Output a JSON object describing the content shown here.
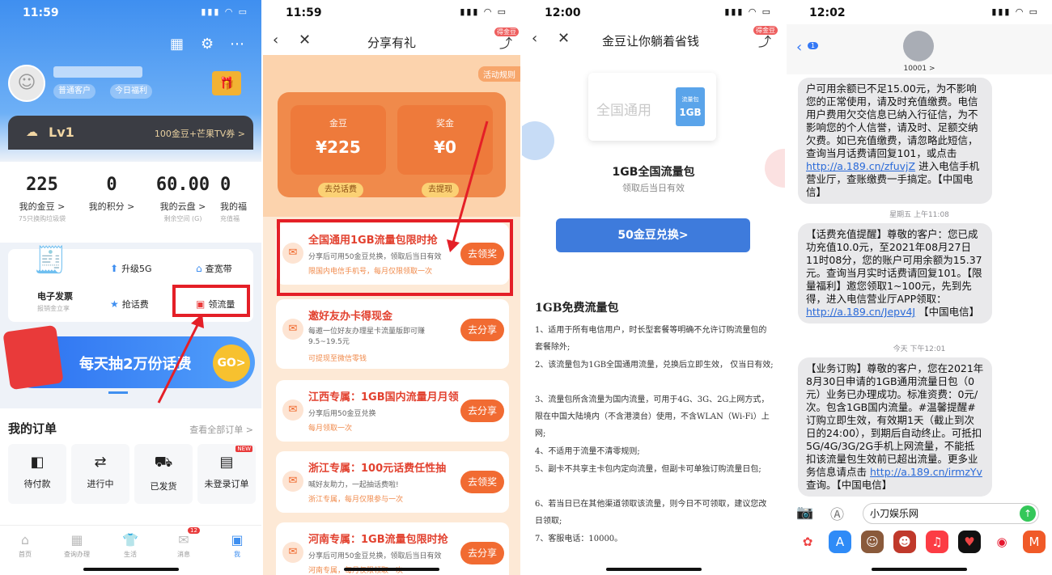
{
  "p1": {
    "time": "11:59",
    "pill1": "普通客户",
    "pill2": "今日福利",
    "lv": "Lv1",
    "lv_promo": "100金豆+芒果TV券 >",
    "stats": [
      {
        "n": "225",
        "l": "我的金豆 >",
        "s": "75只换购垃圾袋"
      },
      {
        "n": "0",
        "l": "我的积分 >",
        "s": ""
      },
      {
        "n": "60.00",
        "l": "我的云盘 >",
        "s": "剩余空间 (G)"
      },
      {
        "n": "0",
        "l": "我的福",
        "s": "充值福"
      }
    ],
    "grid": {
      "invoice": "电子发票",
      "invoice_sub": "报销金立享",
      "upgrade": "升级5G",
      "broadband": "查宽带",
      "phonebill": "抢话费",
      "traffic": "领流量"
    },
    "banner": "每天抽2万份话费",
    "banner_go": "GO>",
    "orders_title": "我的订单",
    "orders_more": "查看全部订单 >",
    "order_items": [
      "待付款",
      "进行中",
      "已发货",
      "未登录订单"
    ],
    "order_new": "NEW",
    "tabs": [
      "首页",
      "查询办理",
      "生活",
      "消息",
      "我"
    ],
    "msg_badge": "12"
  },
  "p2": {
    "time": "11:59",
    "title": "分享有礼",
    "share_badge": "得金豆",
    "rules": "活动规则",
    "coin1_label": "金豆",
    "coin1_value": "¥225",
    "coin2_label": "奖金",
    "coin2_value": "¥0",
    "btn1": "去兑话费",
    "btn2": "去提现",
    "cards": [
      {
        "t": "全国通用1GB流量包限时抢",
        "d": "分享后可用50金豆兑换，领取后当日有效",
        "n": "限国内电信手机号，每月仅限领取一次",
        "b": "去领奖"
      },
      {
        "t": "邀好友办卡得现金",
        "d": "每邀一位好友办理星卡流量版即可赚 9.5~19.5元",
        "n": "可提现至微信零钱",
        "b": "去分享"
      },
      {
        "t": "江西专属：1GB国内流量月月领",
        "d": "分享后用50金豆兑换",
        "n": "每月领取一次",
        "b": "去分享"
      },
      {
        "t": "浙江专属：100元话费任性抽",
        "d": "喊好友助力，一起抽话费啦!",
        "n": "浙江专属，每月仅限参与一次",
        "b": "去领奖"
      },
      {
        "t": "河南专属：1GB流量包限时抢",
        "d": "分享后可用50金豆兑换，领取后当日有效",
        "n": "河南专属，每月仅限领取一次",
        "b": "去分享"
      }
    ]
  },
  "p3": {
    "time": "12:00",
    "title": "金豆让你躺着省钱",
    "share_badge": "得金豆",
    "prod_placeholder": "全国通用",
    "pack_label": "流量包",
    "pack_size": "1GB",
    "name": "1GB全国流量包",
    "desc": "领取后当日有效",
    "btn": "50金豆兑换>",
    "section": "1GB免费流量包",
    "rules": [
      "1、适用于所有电信用户，时长型套餐等明确不允许订购流量包的套餐除外;",
      "2、该流量包为1GB全国通用流量，兑换后立即生效， 仅当日有效;",
      "3、流量包所含流量为国内流量，可用于4G、3G、2G上网方式，限在中国大陆境内（不含港澳台）使用，不含WLAN（Wi-Fi）上网;",
      "4、不适用于流量不清零规则;",
      "5、副卡不共享主卡包内定向流量，但副卡可单独订购流量日包;",
      "6、若当日已在其他渠道领取该流量，则今日不可领取，建议您改日领取;",
      "7、客服电话：10000。"
    ]
  },
  "p4": {
    "time": "12:02",
    "back_badge": "1",
    "contact": "10001 >",
    "msg1_a": "户可用余额已不足15.00元，为不影响您的正常使用，请及时充值缴费。电信用户费用欠交信息已纳入行征信，为不影响您的个人信誉，请及时、足额交纳欠费。如已充值缴费，请忽略此短信，查询当月话费请回复101，或点击 ",
    "msg1_link": "http://a.189.cn/zfuvjZ",
    "msg1_b": " 进入电信手机营业厅，查账缴费一手搞定。【中国电信】",
    "ts1": "星期五 上午11:08",
    "msg2_a": "【话费充值提醒】尊敬的客户：您已成功充值10.0元，至2021年08月27日 11时08分，您的账户可用余额为15.37元。查询当月实时话费请回复101。【限量福利】邀您领取1~100元，先到先得，进入电信营业厅APP领取： ",
    "msg2_link": "http://a.189.cn/Jepv4J",
    "msg2_b": " 【中国电信】",
    "ts2": "今天 下午12:01",
    "msg3_a": "【业务订购】尊敬的客户，您在2021年8月30日申请的1GB通用流量日包（0元）业务已办理成功。标准资费：0元/次。包含1GB国内流量。#温馨提醒#订购立即生效，有效期1天（截止到次日的24:00），到期后自动终止。可抵扣5G/4G/3G/2G手机上网流量，不能抵扣该流量包生效前已超出流量。更多业务信息请点击 ",
    "msg3_link": "http://a.189.cn/irmzYv",
    "msg3_b": " 查询。【中国电信】",
    "input": "小刀娱乐网"
  }
}
